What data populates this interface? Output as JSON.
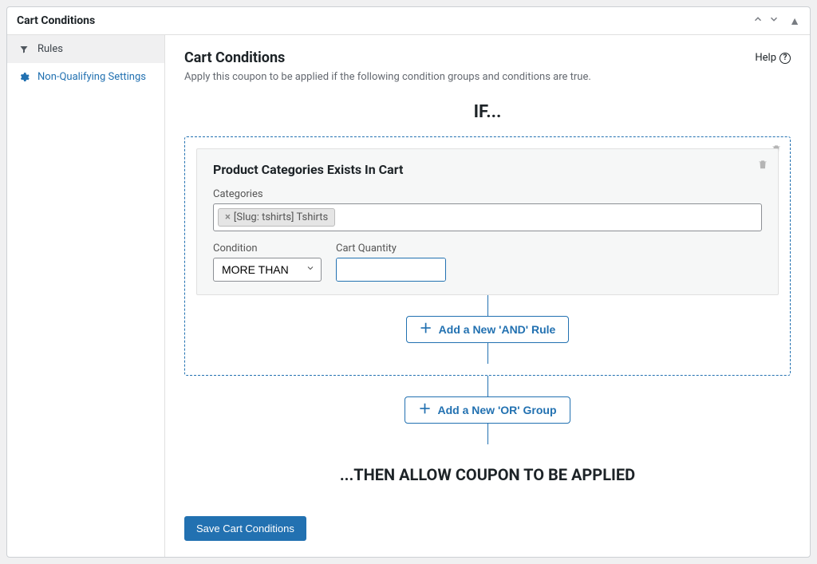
{
  "panel": {
    "title": "Cart Conditions"
  },
  "sidebar": {
    "items": [
      {
        "label": "Rules"
      },
      {
        "label": "Non-Qualifying Settings"
      }
    ]
  },
  "content": {
    "heading": "Cart Conditions",
    "help_label": "Help",
    "description": "Apply this coupon to be applied if the following condition groups and conditions are true.",
    "if_heading": "IF...",
    "then_heading": "...THEN ALLOW COUPON TO BE APPLIED",
    "add_and_label": "Add a New 'AND' Rule",
    "add_or_label": "Add a New 'OR' Group",
    "save_label": "Save Cart Conditions"
  },
  "rule": {
    "title": "Product Categories Exists In Cart",
    "categories_label": "Categories",
    "tag_text": "[Slug: tshirts] Tshirts",
    "condition_label": "Condition",
    "condition_value": "MORE THAN",
    "quantity_label": "Cart Quantity",
    "quantity_value": ""
  }
}
